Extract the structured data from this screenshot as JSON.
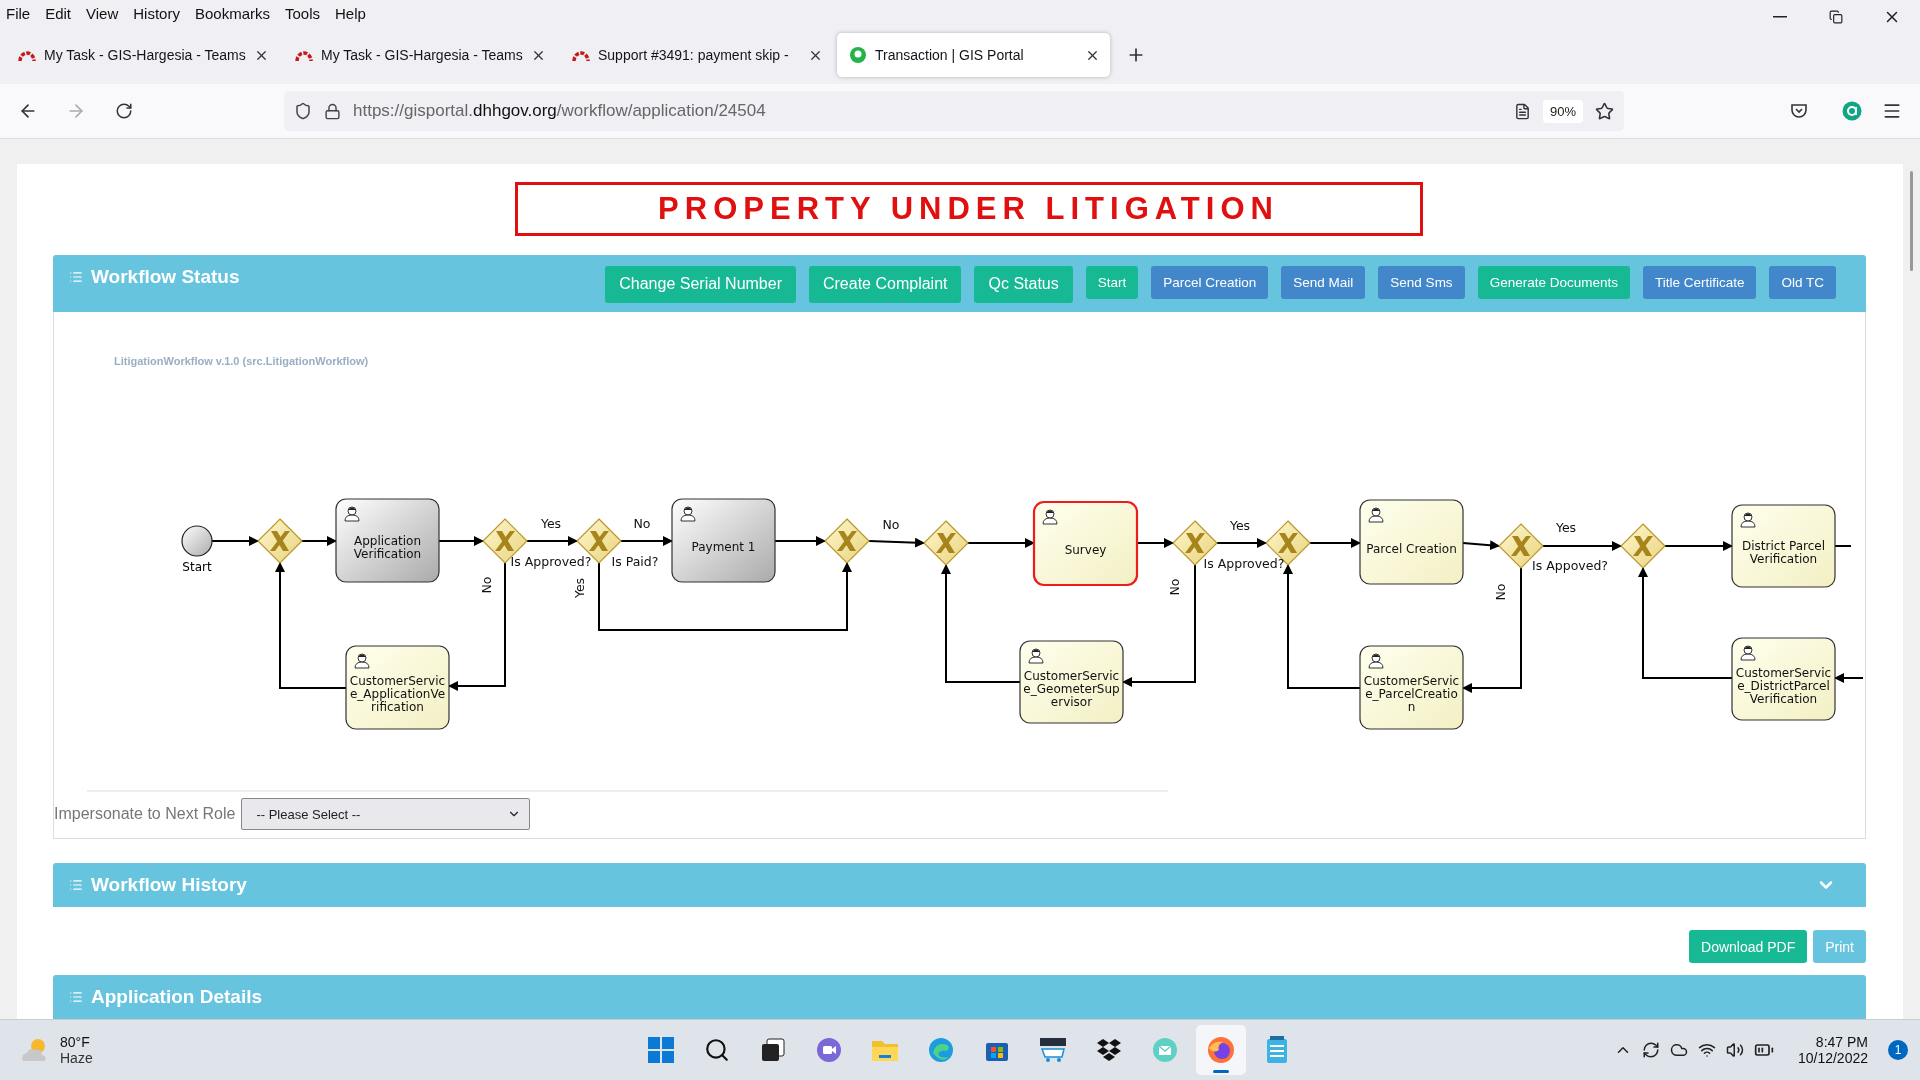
{
  "menu_bar": [
    "File",
    "Edit",
    "View",
    "History",
    "Bookmarks",
    "Tools",
    "Help"
  ],
  "tabs": [
    {
      "title": "My Task - GIS-Hargesia - Teams",
      "selected": false
    },
    {
      "title": "My Task - GIS-Hargesia - Teams",
      "selected": false
    },
    {
      "title": "Support #3491: payment skip -",
      "selected": false
    },
    {
      "title": "Transaction | GIS Portal",
      "selected": true
    }
  ],
  "address_bar": {
    "url_prefix": "https://gisportal.",
    "url_domain": "dhhgov.org",
    "url_path": "/workflow/application/24504",
    "zoom": "90%"
  },
  "banner": "PROPERTY UNDER LITIGATION",
  "workflow_status": {
    "title": "Workflow Status",
    "buttons": [
      {
        "label": "Change Serial Number",
        "color": "#17b994",
        "kind": "large"
      },
      {
        "label": "Create Complaint",
        "color": "#17b994",
        "kind": "large"
      },
      {
        "label": "Qc Status",
        "color": "#17b994",
        "kind": "large"
      },
      {
        "label": "Start",
        "color": "#17b994",
        "kind": "small"
      },
      {
        "label": "Parcel Creation",
        "color": "#4387cb",
        "kind": "small"
      },
      {
        "label": "Send Mail",
        "color": "#4387cb",
        "kind": "small"
      },
      {
        "label": "Send Sms",
        "color": "#4387cb",
        "kind": "small"
      },
      {
        "label": "Generate Documents",
        "color": "#17b994",
        "kind": "small"
      },
      {
        "label": "Title Certificate",
        "color": "#4387cb",
        "kind": "small"
      },
      {
        "label": "Old TC",
        "color": "#4387cb",
        "kind": "small"
      }
    ]
  },
  "diagram": {
    "caption": "LitigationWorkflow v.1.0 (src.LitigationWorkflow)",
    "nodes": [
      {
        "kind": "start",
        "label": "Start"
      },
      {
        "kind": "gateway"
      },
      {
        "kind": "task",
        "label": "Application Verification",
        "completed": true,
        "selected": false
      },
      {
        "kind": "gateway"
      },
      {
        "kind": "gateway"
      },
      {
        "kind": "task",
        "label": "Payment 1",
        "completed": true,
        "selected": false
      },
      {
        "kind": "gateway"
      },
      {
        "kind": "gateway"
      },
      {
        "kind": "task",
        "label": "Survey",
        "completed": false,
        "selected": true
      },
      {
        "kind": "gateway"
      },
      {
        "kind": "gateway"
      },
      {
        "kind": "task",
        "label": "Parcel Creation",
        "completed": false,
        "selected": false
      },
      {
        "kind": "gateway"
      },
      {
        "kind": "gateway"
      },
      {
        "kind": "task",
        "label": "District Parcel Verification",
        "completed": false,
        "selected": false
      },
      {
        "kind": "task",
        "label": "CustomerService_ApplicationVerification",
        "completed": false,
        "selected": false
      },
      {
        "kind": "task",
        "label": "CustomerService_GeometerSupervisor",
        "completed": false,
        "selected": false
      },
      {
        "kind": "task",
        "label": "CustomerService_ParcelCreation",
        "completed": false,
        "selected": false
      },
      {
        "kind": "task",
        "label": "CustomerService_DistrictParcelVerification",
        "completed": false,
        "selected": false
      }
    ],
    "edge_labels": [
      {
        "text": "Yes",
        "kind": "horizontal"
      },
      {
        "text": "No",
        "kind": "horizontal"
      },
      {
        "text": "No",
        "kind": "horizontal"
      },
      {
        "text": "Yes",
        "kind": "horizontal"
      },
      {
        "text": "Yes",
        "kind": "horizontal"
      },
      {
        "text": "Is Approved?",
        "kind": "horizontal"
      },
      {
        "text": "Is Paid?",
        "kind": "horizontal"
      },
      {
        "text": "Is Approved?",
        "kind": "horizontal"
      },
      {
        "text": "Is Appoved?",
        "kind": "horizontal"
      },
      {
        "text": "No",
        "kind": "vertical"
      },
      {
        "text": "Yes",
        "kind": "vertical"
      },
      {
        "text": "No",
        "kind": "vertical"
      },
      {
        "text": "No",
        "kind": "vertical"
      }
    ]
  },
  "impersonate": {
    "label": "Impersonate to Next Role",
    "value": "-- Please Select --"
  },
  "workflow_history": {
    "title": "Workflow History",
    "expanded": false
  },
  "actions": [
    {
      "label": "Download PDF",
      "color": "#17b994"
    },
    {
      "label": "Print",
      "color": "#67c4de"
    }
  ],
  "application_details": {
    "title": "Application Details"
  },
  "taskbar": {
    "temperature": "80°F",
    "weather": "Haze",
    "apps": [
      {
        "kind": "start",
        "selected": false
      },
      {
        "kind": "search",
        "selected": false
      },
      {
        "kind": "taskview",
        "selected": false
      },
      {
        "kind": "teams",
        "selected": false
      },
      {
        "kind": "explorer",
        "selected": false
      },
      {
        "kind": "edge",
        "selected": false
      },
      {
        "kind": "store",
        "selected": false
      },
      {
        "kind": "amazon",
        "selected": false
      },
      {
        "kind": "dropbox",
        "selected": false
      },
      {
        "kind": "mail",
        "selected": false
      },
      {
        "kind": "firefox",
        "selected": true
      },
      {
        "kind": "notepad",
        "selected": false
      }
    ],
    "time": "8:47 PM",
    "date": "10/12/2022",
    "notifications": "1"
  }
}
